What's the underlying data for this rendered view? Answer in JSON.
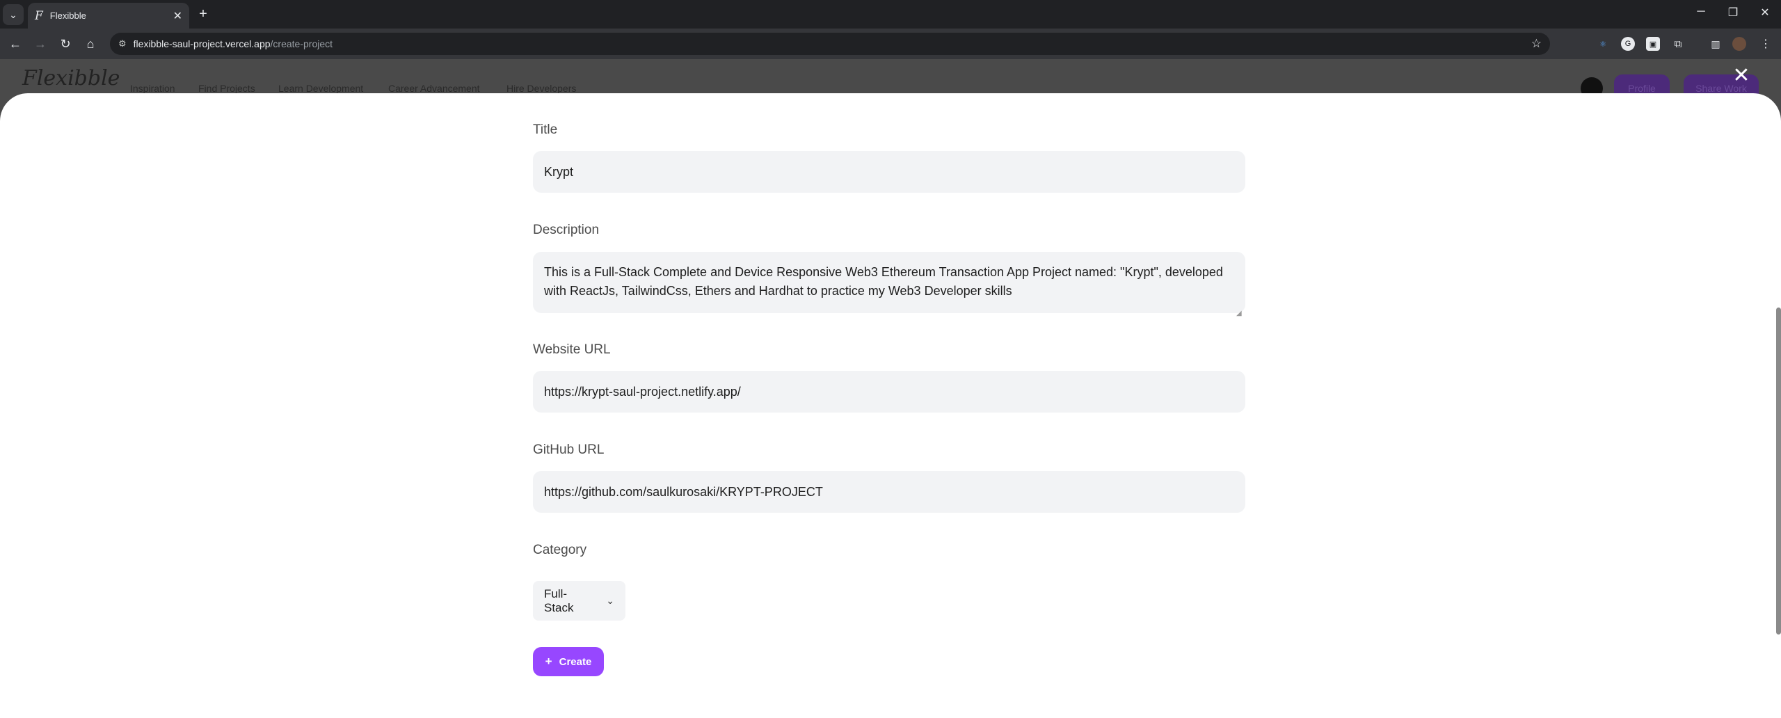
{
  "browser": {
    "tab_title": "Flexibble",
    "url_host": "flexibble-saul-project.vercel.app",
    "url_path": "/create-project"
  },
  "site": {
    "logo": "Flexibble",
    "nav": [
      "Inspiration",
      "Find Projects",
      "Learn Development",
      "Career Advancement",
      "Hire Developers"
    ],
    "profile_label": "Profile",
    "share_label": "Share Work"
  },
  "form": {
    "title_label": "Title",
    "title_value": "Krypt",
    "description_label": "Description",
    "description_value": "This is a Full-Stack Complete and Device Responsive Web3 Ethereum Transaction App Project named: \"Krypt\", developed with ReactJs, TailwindCss, Ethers and Hardhat to practice my Web3 Developer skills",
    "website_label": "Website URL",
    "website_value": "https://krypt-saul-project.netlify.app/",
    "github_label": "GitHub URL",
    "github_value": "https://github.com/saulkurosaki/KRYPT-PROJECT",
    "category_label": "Category",
    "category_value": "Full-Stack",
    "create_label": "Create"
  },
  "colors": {
    "accent": "#9747ff",
    "input_bg": "#f2f3f5"
  }
}
